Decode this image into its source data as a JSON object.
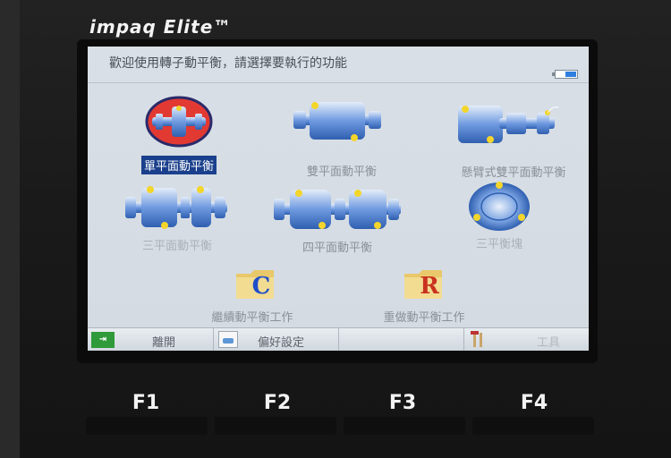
{
  "device": {
    "brand": "impaq Elite™"
  },
  "screen": {
    "title": "歡迎使用轉子動平衡，請選擇要執行的功能"
  },
  "menu": [
    {
      "id": "single-plane",
      "label": "單平面動平衡",
      "selected": true,
      "enabled": true,
      "icon": "single-plane-rotor-icon"
    },
    {
      "id": "two-plane",
      "label": "雙平面動平衡",
      "selected": false,
      "enabled": true,
      "icon": "two-plane-rotor-icon"
    },
    {
      "id": "overhung",
      "label": "懸臂式雙平面動平衡",
      "selected": false,
      "enabled": true,
      "icon": "overhung-rotor-icon"
    },
    {
      "id": "three-plane",
      "label": "三平面動平衡",
      "selected": false,
      "enabled": false,
      "icon": "three-plane-rotor-icon"
    },
    {
      "id": "four-plane",
      "label": "四平面動平衡",
      "selected": false,
      "enabled": true,
      "icon": "four-plane-rotor-icon"
    },
    {
      "id": "three-weight",
      "label": "三平衡塊",
      "selected": false,
      "enabled": false,
      "icon": "three-weight-disc-icon"
    },
    {
      "id": "continue",
      "label": "繼續動平衡工作",
      "selected": false,
      "enabled": true,
      "icon": "continue-folder-icon",
      "letter": "C",
      "letter_color": "#1f4fc9"
    },
    {
      "id": "redo",
      "label": "重做動平衡工作",
      "selected": false,
      "enabled": true,
      "icon": "redo-folder-icon",
      "letter": "R",
      "letter_color": "#c9321f"
    }
  ],
  "softkeys": [
    {
      "label": "離開",
      "icon": "exit-icon",
      "enabled": true
    },
    {
      "label": "偏好設定",
      "icon": "preferences-icon",
      "enabled": true
    },
    {
      "label": "",
      "icon": "",
      "enabled": false
    },
    {
      "label": "工具",
      "icon": "tools-icon",
      "enabled": false
    }
  ],
  "fkeys": [
    "F1",
    "F2",
    "F3",
    "F4"
  ],
  "colors": {
    "selection": "#1a3f8c",
    "rotor_body": "#5f8fd6",
    "weight_marker": "#f3d52b",
    "battery": "#2f7fe0"
  }
}
